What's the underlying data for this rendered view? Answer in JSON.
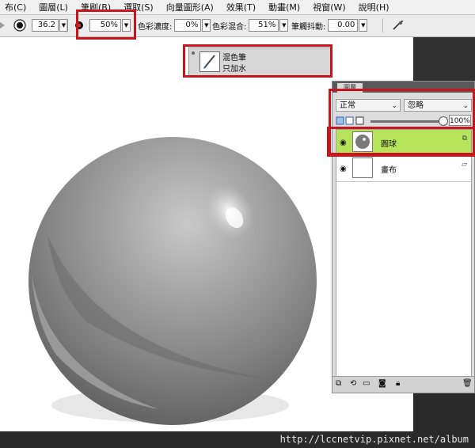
{
  "menu": [
    "布(C)",
    "圖層(L)",
    "筆刷(B)",
    "選取(S)",
    "向量圖形(A)",
    "效果(T)",
    "動畫(M)",
    "視窗(W)",
    "說明(H)"
  ],
  "propbar": {
    "size_value": "36.2",
    "opacity_value": "50%",
    "resaturation_label": "色彩濃度:",
    "resaturation_value": "0%",
    "bleed_label": "色彩混合:",
    "bleed_value": "51%",
    "jitter_label": "筆觸抖動:",
    "jitter_value": "0.00"
  },
  "variant_popup": {
    "category": "混色筆",
    "variant": "只加水"
  },
  "layers_panel": {
    "tab_label": "圖層",
    "composite_method": "正常",
    "composite_depth": "忽略",
    "opacity": "100%",
    "layers": [
      {
        "name": "圓球",
        "selected": true
      },
      {
        "name": "畫布",
        "selected": false
      }
    ]
  },
  "watermark": "http://lccnetvip.pixnet.net/album",
  "colors": {
    "selected_layer": "#b5e35a",
    "highlight": "#c4161c"
  }
}
